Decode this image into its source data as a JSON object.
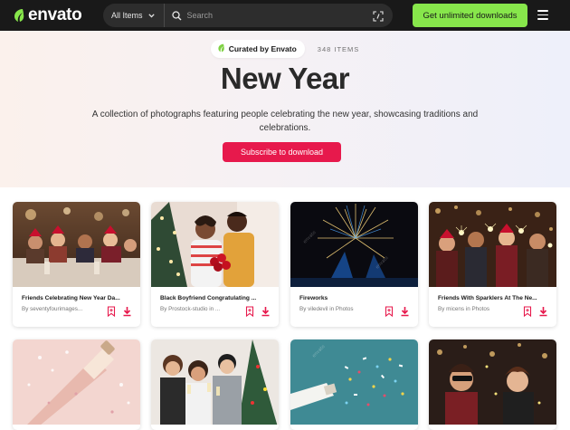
{
  "header": {
    "logo_text": "envato",
    "search": {
      "scope": "All Items",
      "placeholder": "Search"
    },
    "cta_label": "Get unlimited downloads",
    "accent_green": "#87e64b"
  },
  "hero": {
    "badge": "Curated by Envato",
    "count": "348 ITEMS",
    "title": "New Year",
    "description": "A collection of photographs featuring people celebrating the new year, showcasing traditions and celebrations.",
    "subscribe_label": "Subscribe to download",
    "accent_red": "#e7194c"
  },
  "cards": [
    {
      "title": "Friends Celebrating New Year Da...",
      "author": "By seventyfourimages...",
      "thumbnail": "dinner-party-photo"
    },
    {
      "title": "Black Boyfriend Congratulating ...",
      "author": "By Prostock-studio in ...",
      "thumbnail": "couple-roses-photo"
    },
    {
      "title": "Fireworks",
      "author": "By viledevil in Photos",
      "thumbnail": "fireworks-photo"
    },
    {
      "title": "Friends With Sparklers At The Ne...",
      "author": "By micens in Photos",
      "thumbnail": "sparklers-photo"
    },
    {
      "thumbnail": "champagne-bottle-photo"
    },
    {
      "thumbnail": "friends-toast-photo"
    },
    {
      "thumbnail": "confetti-bottle-photo"
    },
    {
      "thumbnail": "party-selfie-photo"
    }
  ],
  "icons": {
    "logo": "envato-leaf-icon",
    "chevron": "chevron-down-icon",
    "search": "search-icon",
    "visual_search": "visual-search-icon",
    "menu": "hamburger-menu-icon",
    "badge": "envato-leaf-icon",
    "bookmark": "bookmark-icon",
    "download": "download-icon"
  }
}
